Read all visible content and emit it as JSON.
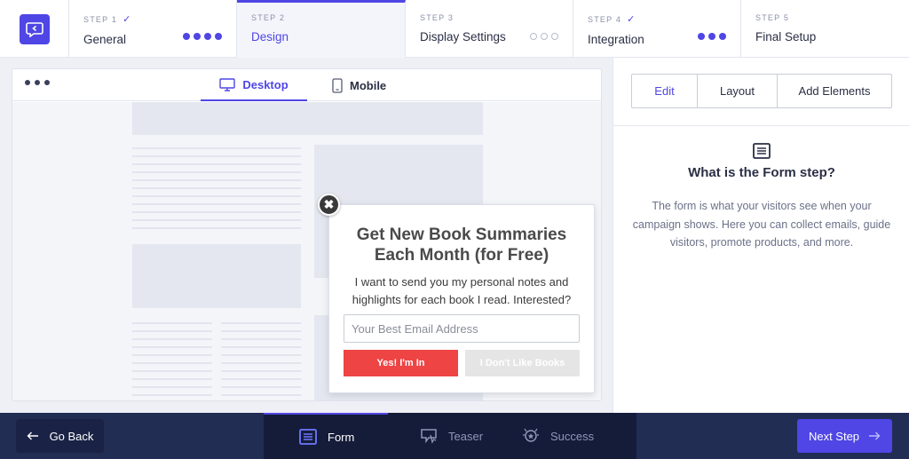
{
  "steps": [
    {
      "num": "STEP 1",
      "title": "General",
      "check": "✓"
    },
    {
      "num": "STEP 2",
      "title": "Design"
    },
    {
      "num": "STEP 3",
      "title": "Display Settings"
    },
    {
      "num": "STEP 4",
      "title": "Integration",
      "check": "✓"
    },
    {
      "num": "STEP 5",
      "title": "Final Setup"
    }
  ],
  "preview": {
    "tabs": {
      "desktop": "Desktop",
      "mobile": "Mobile"
    }
  },
  "popup": {
    "close": "✖",
    "title": "Get New Book Summaries Each Month (for Free)",
    "body": "I want to send you my personal notes and highlights for each book I read. Interested?",
    "email_placeholder": "Your Best Email Address",
    "yes_label": "Yes! I'm In",
    "no_label": "I Don't Like Books"
  },
  "panel": {
    "tabs": {
      "edit": "Edit",
      "layout": "Layout",
      "add": "Add Elements"
    },
    "heading": "What is the Form step?",
    "description": "The form is what your visitors see when your campaign shows. Here you can collect emails, guide visitors, promote products, and more."
  },
  "bottom": {
    "go_back": "Go Back",
    "tabs": {
      "form": "Form",
      "teaser": "Teaser",
      "success": "Success"
    },
    "next_step": "Next Step"
  },
  "colors": {
    "accent": "#4f46e5",
    "yes_button": "#ef4444",
    "bottom_bar": "#222d54"
  }
}
